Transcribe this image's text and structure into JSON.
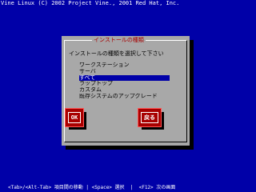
{
  "banner": "Vine Linux (C) 2002 Project Vine., 2001 Red Hat, Inc.",
  "dialog": {
    "title": "インストールの種類",
    "prompt": "インストールの種類を選択して下さい",
    "options": [
      "ワークステーション",
      "サーバ",
      "すべて",
      "ラップトップ",
      "カスタム",
      "既存システムのアップグレード"
    ],
    "selected_option": "すべて",
    "ok_label": "OK",
    "back_label": "戻る"
  },
  "help_line": "<Tab>/<Alt-Tab> 項目間の移動 | <Space> 選択  |  <F12> 次の画面",
  "colors": {
    "screen_background": "#0000a8",
    "dialog_background": "#a8a8a8",
    "title_text": "#a80000",
    "selection_highlight": "#0000a8",
    "button_background": "#a80000"
  }
}
